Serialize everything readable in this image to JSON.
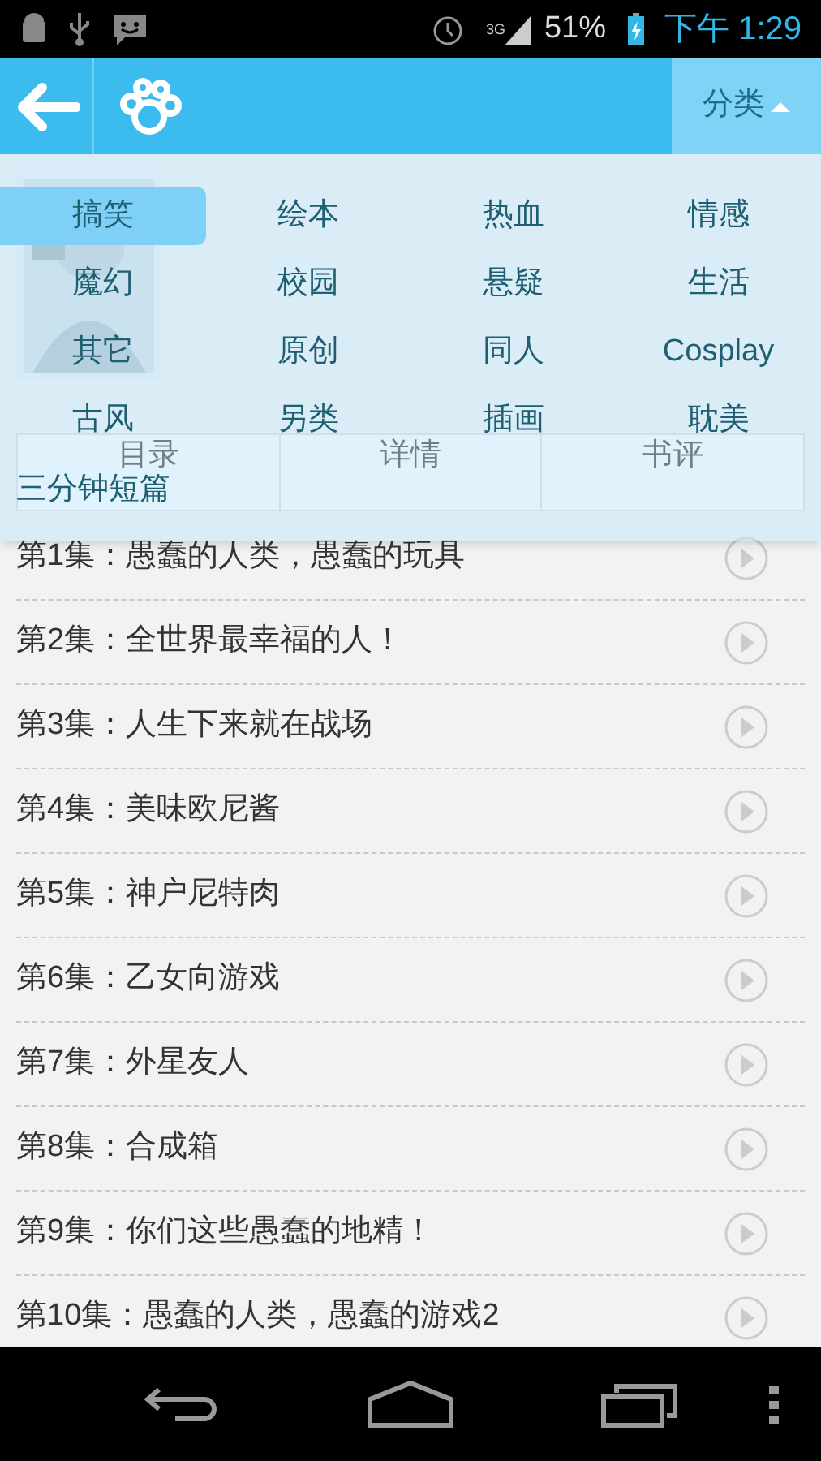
{
  "status_bar": {
    "network": "3G",
    "battery": "51%",
    "time": "下午 1:29"
  },
  "header": {
    "category_button": "分类",
    "expanded": true
  },
  "book_tabs": [
    "目录",
    "详情",
    "书评"
  ],
  "categories": [
    {
      "label": "搞笑",
      "selected": true
    },
    {
      "label": "绘本",
      "selected": false
    },
    {
      "label": "热血",
      "selected": false
    },
    {
      "label": "情感",
      "selected": false
    },
    {
      "label": "魔幻",
      "selected": false
    },
    {
      "label": "校园",
      "selected": false
    },
    {
      "label": "悬疑",
      "selected": false
    },
    {
      "label": "生活",
      "selected": false
    },
    {
      "label": "其它",
      "selected": false
    },
    {
      "label": "原创",
      "selected": false
    },
    {
      "label": "同人",
      "selected": false
    },
    {
      "label": "Cosplay",
      "selected": false
    },
    {
      "label": "古风",
      "selected": false
    },
    {
      "label": "另类",
      "selected": false
    },
    {
      "label": "插画",
      "selected": false
    },
    {
      "label": "耽美",
      "selected": false
    },
    {
      "label": "三分钟短篇",
      "selected": false
    }
  ],
  "episodes": [
    {
      "title": "第1集：愚蠢的人类，愚蠢的玩具"
    },
    {
      "title": "第2集：全世界最幸福的人！"
    },
    {
      "title": "第3集：人生下来就在战场"
    },
    {
      "title": "第4集：美味欧尼酱"
    },
    {
      "title": "第5集：神户尼特肉"
    },
    {
      "title": "第6集：乙女向游戏"
    },
    {
      "title": "第7集：外星友人"
    },
    {
      "title": "第8集：合成箱"
    },
    {
      "title": "第9集：你们这些愚蠢的地精！"
    },
    {
      "title": "第10集：愚蠢的人类，愚蠢的游戏2"
    }
  ]
}
